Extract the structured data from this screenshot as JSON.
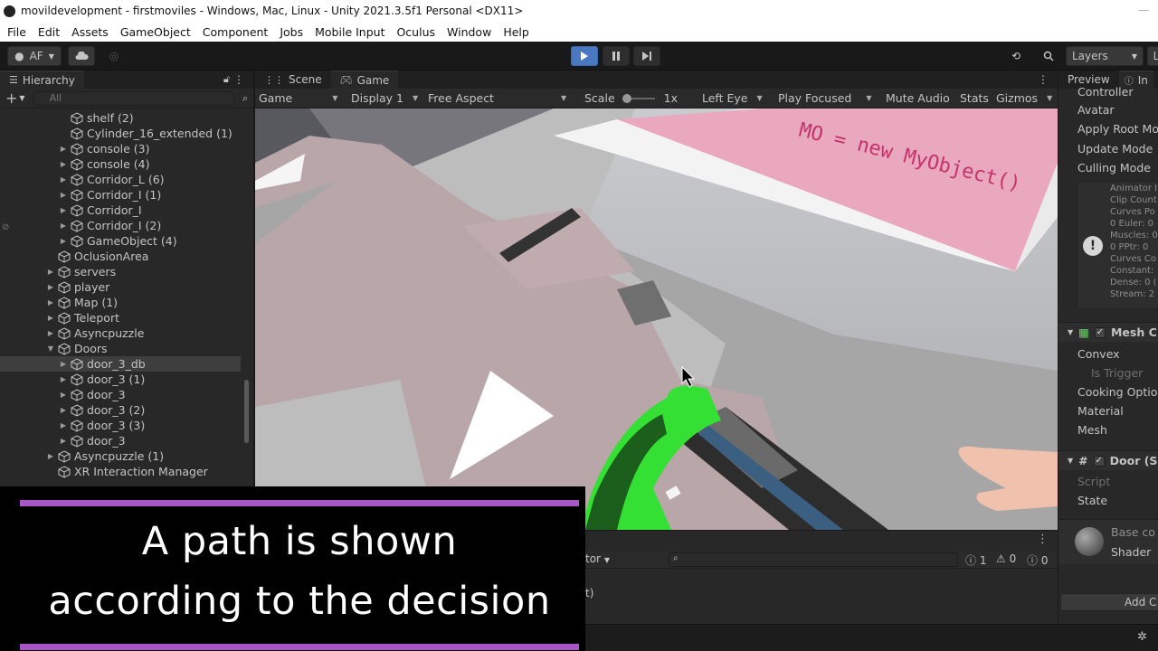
{
  "window": {
    "title": "movildevelopment - firstmoviles - Windows, Mac, Linux - Unity 2021.3.5f1 Personal <DX11>"
  },
  "menu": [
    "File",
    "Edit",
    "Assets",
    "GameObject",
    "Component",
    "Jobs",
    "Mobile Input",
    "Oculus",
    "Window",
    "Help"
  ],
  "toolbar": {
    "account_label": "AF",
    "layers_label": "Layers",
    "layout_label": "L"
  },
  "hierarchy": {
    "tab_label": "Hierarchy",
    "search_placeholder": "All",
    "items": [
      {
        "label": "shelf (2)",
        "depth": 2,
        "arrow": false
      },
      {
        "label": "Cylinder_16_extended (1)",
        "depth": 2,
        "arrow": false
      },
      {
        "label": "console (3)",
        "depth": 2,
        "arrow": true
      },
      {
        "label": "console (4)",
        "depth": 2,
        "arrow": true
      },
      {
        "label": "Corridor_L (6)",
        "depth": 2,
        "arrow": true
      },
      {
        "label": "Corridor_I (1)",
        "depth": 2,
        "arrow": true
      },
      {
        "label": "Corridor_I",
        "depth": 2,
        "arrow": true
      },
      {
        "label": "Corridor_I (2)",
        "depth": 2,
        "arrow": true
      },
      {
        "label": "GameObject (4)",
        "depth": 2,
        "arrow": true
      },
      {
        "label": "OclusionArea",
        "depth": 1,
        "arrow": false
      },
      {
        "label": "servers",
        "depth": 1,
        "arrow": true
      },
      {
        "label": "player",
        "depth": 1,
        "arrow": true
      },
      {
        "label": "Map (1)",
        "depth": 1,
        "arrow": true
      },
      {
        "label": "Teleport",
        "depth": 1,
        "arrow": true
      },
      {
        "label": "Asyncpuzzle",
        "depth": 1,
        "arrow": true
      },
      {
        "label": "Doors",
        "depth": 1,
        "arrow": true,
        "expanded": true
      },
      {
        "label": "door_3_db",
        "depth": 2,
        "arrow": true,
        "selected": true
      },
      {
        "label": "door_3 (1)",
        "depth": 2,
        "arrow": true
      },
      {
        "label": "door_3",
        "depth": 2,
        "arrow": true
      },
      {
        "label": "door_3 (2)",
        "depth": 2,
        "arrow": true
      },
      {
        "label": "door_3 (3)",
        "depth": 2,
        "arrow": true
      },
      {
        "label": "door_3",
        "depth": 2,
        "arrow": true
      },
      {
        "label": "Asyncpuzzle (1)",
        "depth": 1,
        "arrow": true
      },
      {
        "label": "XR Interaction Manager",
        "depth": 1,
        "arrow": false
      }
    ]
  },
  "game_view": {
    "tabs": [
      "Scene",
      "Game"
    ],
    "active_tab": "Game",
    "controls": {
      "mode": "Game",
      "display": "Display 1",
      "aspect": "Free Aspect",
      "scale_label": "Scale",
      "scale_value": "1x",
      "eye": "Left Eye",
      "play_mode": "Play Focused",
      "mute": "Mute Audio",
      "stats": "Stats",
      "gizmos": "Gizmos"
    },
    "scene_text": "MO = new MyObject()"
  },
  "inspector": {
    "tabs": [
      "Preview",
      "In"
    ],
    "fields": [
      "Controller",
      "Avatar",
      "Apply Root Mo",
      "Update Mode",
      "Culling Mode"
    ],
    "animator_info": [
      "Animator I",
      "Clip Count",
      "Curves Po",
      "0 Euler: 0",
      "Muscles: 0",
      "0 PPtr: 0",
      "Curves Co",
      "Constant:",
      "Dense: 0 (",
      "Stream: 2"
    ],
    "mesh_collider": {
      "title": "Mesh C",
      "fields": [
        "Convex",
        "Is Trigger",
        "Cooking Optio",
        "Material",
        "Mesh"
      ]
    },
    "door_script": {
      "title": "Door (S",
      "fields": [
        "Script",
        "State"
      ]
    },
    "material": {
      "name": "Base co",
      "shader_label": "Shader"
    },
    "add_component": "Add C"
  },
  "console": {
    "dropdown_partial": "tor",
    "log_partial": "t)",
    "counts": {
      "info": "1",
      "warning": "0",
      "error": "0"
    }
  },
  "caption": {
    "line1": "A path is shown",
    "line2": "according to the decision"
  }
}
